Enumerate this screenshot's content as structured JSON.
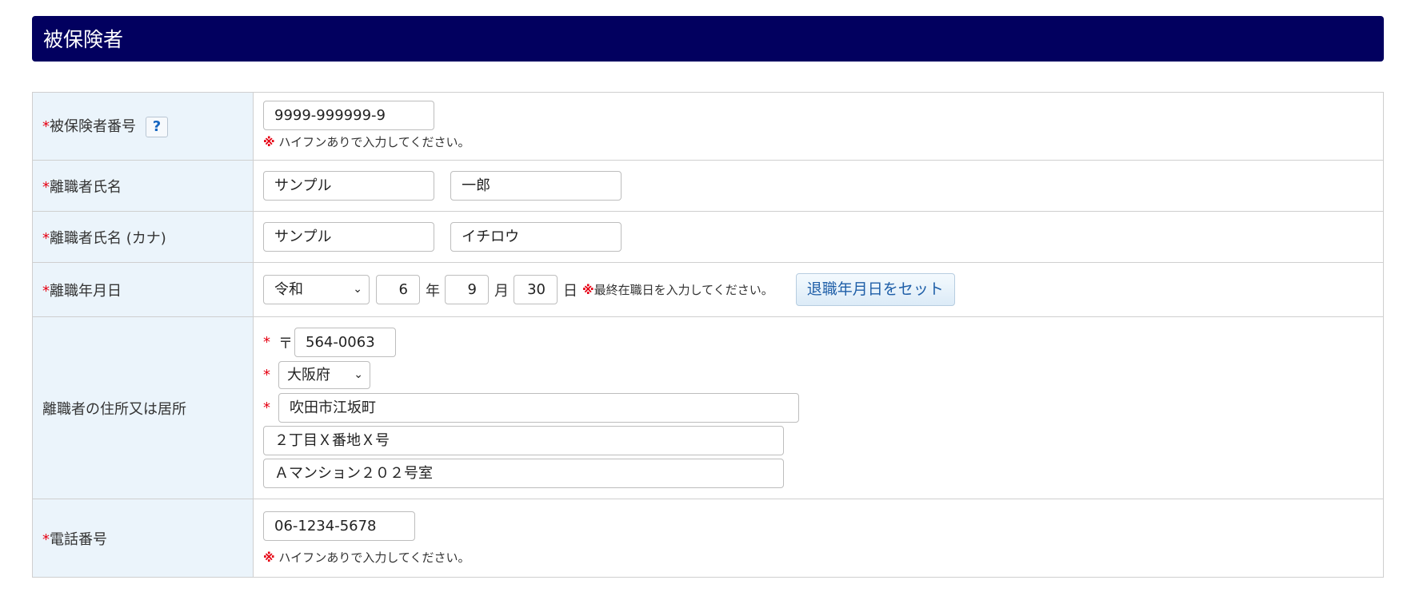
{
  "header": {
    "title": "被保険者"
  },
  "required_mark": "*",
  "note_mark": "※",
  "help_label": "?",
  "insured_number": {
    "label": "被保険者番号",
    "value": "9999-999999-9",
    "note": "ハイフンありで入力してください。"
  },
  "name": {
    "label": "離職者氏名",
    "last": "サンプル",
    "first": "一郎"
  },
  "name_kana": {
    "label": "離職者氏名 (カナ)",
    "last": "サンプル",
    "first": "イチロウ"
  },
  "leave_date": {
    "label": "離職年月日",
    "era": "令和",
    "year": "6",
    "year_unit": "年",
    "month": "9",
    "month_unit": "月",
    "day": "30",
    "day_unit": "日",
    "note": "最終在職日を入力してください。",
    "set_button": "退職年月日をセット"
  },
  "address": {
    "label": "離職者の住所又は居所",
    "zip_mark": "〒",
    "zip": "564-0063",
    "prefecture": "大阪府",
    "city": "吹田市江坂町",
    "line1": "２丁目Ｘ番地Ｘ号",
    "line2": "Ａマンション２０２号室"
  },
  "phone": {
    "label": "電話番号",
    "value": "06-1234-5678",
    "note": "ハイフンありで入力してください。"
  },
  "icons": {
    "select_chevron": "chevron-down-icon",
    "help": "help-icon"
  }
}
